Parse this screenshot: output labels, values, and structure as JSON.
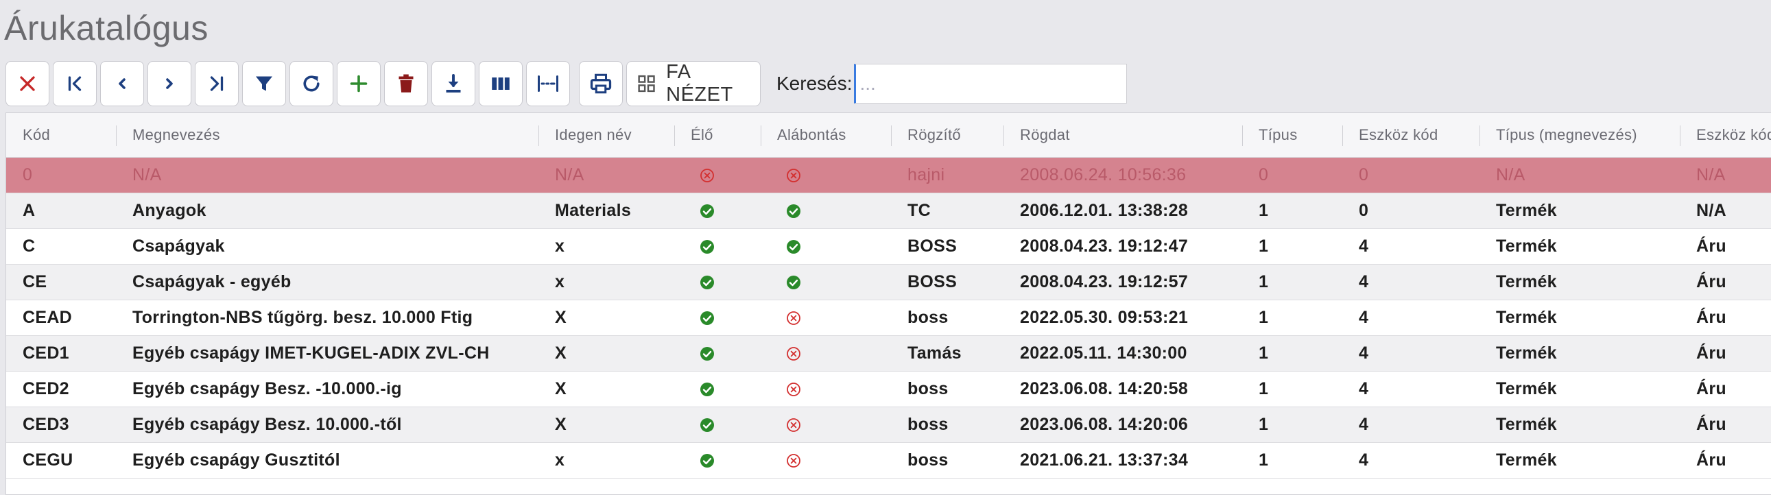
{
  "title": "Árukatalógus",
  "toolbar": {
    "tree_view_label": "FA NÉZET",
    "search_label": "Keresés:",
    "search_placeholder": "...",
    "search_value": ""
  },
  "colors": {
    "danger": "#c62828",
    "navy": "#1d3f80",
    "green": "#2e8b2e",
    "delete": "#8b1a1a",
    "selected_row": "#d5838f",
    "ok_icon": "#2a8a2a",
    "no_icon": "#d32f2f"
  },
  "table": {
    "columns": [
      "Kód",
      "Megnevezés",
      "Idegen név",
      "Élő",
      "Alábontás",
      "Rögzítő",
      "Rögdat",
      "Típus",
      "Eszköz kód",
      "Típus (megnevezés)",
      "Eszköz kód"
    ],
    "rows": [
      {
        "kod": "0",
        "megnevezes": "N/A",
        "idegen": "N/A",
        "elo": "no",
        "alabontas": "no",
        "rogzito": "hajni",
        "rogdat": "2008.06.24. 10:56:36",
        "tipus": "0",
        "eszkoz": "0",
        "tipus_megn": "N/A",
        "eszkoz2": "N/A",
        "selected": true
      },
      {
        "kod": "A",
        "megnevezes": "Anyagok",
        "idegen": "Materials",
        "elo": "ok",
        "alabontas": "ok",
        "rogzito": "TC",
        "rogdat": "2006.12.01. 13:38:28",
        "tipus": "1",
        "eszkoz": "0",
        "tipus_megn": "Termék",
        "eszkoz2": "N/A"
      },
      {
        "kod": "C",
        "megnevezes": "Csapágyak",
        "idegen": "x",
        "elo": "ok",
        "alabontas": "ok",
        "rogzito": "BOSS",
        "rogdat": "2008.04.23. 19:12:47",
        "tipus": "1",
        "eszkoz": "4",
        "tipus_megn": "Termék",
        "eszkoz2": "Áru"
      },
      {
        "kod": "CE",
        "megnevezes": "Csapágyak - egyéb",
        "idegen": "x",
        "elo": "ok",
        "alabontas": "ok",
        "rogzito": "BOSS",
        "rogdat": "2008.04.23. 19:12:57",
        "tipus": "1",
        "eszkoz": "4",
        "tipus_megn": "Termék",
        "eszkoz2": "Áru"
      },
      {
        "kod": "CEAD",
        "megnevezes": "Torrington-NBS tűgörg. besz. 10.000 Ftig",
        "idegen": "X",
        "elo": "ok",
        "alabontas": "no",
        "rogzito": "boss",
        "rogdat": "2022.05.30. 09:53:21",
        "tipus": "1",
        "eszkoz": "4",
        "tipus_megn": "Termék",
        "eszkoz2": "Áru"
      },
      {
        "kod": "CED1",
        "megnevezes": "Egyéb csapágy IMET-KUGEL-ADIX ZVL-CH",
        "idegen": "X",
        "elo": "ok",
        "alabontas": "no",
        "rogzito": "Tamás",
        "rogdat": "2022.05.11. 14:30:00",
        "tipus": "1",
        "eszkoz": "4",
        "tipus_megn": "Termék",
        "eszkoz2": "Áru"
      },
      {
        "kod": "CED2",
        "megnevezes": "Egyéb csapágy Besz. -10.000.-ig",
        "idegen": "X",
        "elo": "ok",
        "alabontas": "no",
        "rogzito": "boss",
        "rogdat": "2023.06.08. 14:20:58",
        "tipus": "1",
        "eszkoz": "4",
        "tipus_megn": "Termék",
        "eszkoz2": "Áru"
      },
      {
        "kod": "CED3",
        "megnevezes": "Egyéb csapágy Besz. 10.000.-től",
        "idegen": "X",
        "elo": "ok",
        "alabontas": "no",
        "rogzito": "boss",
        "rogdat": "2023.06.08. 14:20:06",
        "tipus": "1",
        "eszkoz": "4",
        "tipus_megn": "Termék",
        "eszkoz2": "Áru"
      },
      {
        "kod": "CEGU",
        "megnevezes": "Egyéb csapágy Gusztitól",
        "idegen": "x",
        "elo": "ok",
        "alabontas": "no",
        "rogzito": "boss",
        "rogdat": "2021.06.21. 13:37:34",
        "tipus": "1",
        "eszkoz": "4",
        "tipus_megn": "Termék",
        "eszkoz2": "Áru"
      }
    ]
  }
}
